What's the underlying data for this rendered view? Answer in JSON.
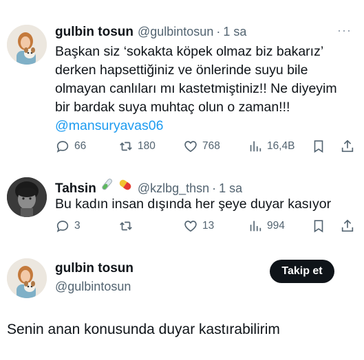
{
  "tweet1": {
    "name": "gulbin tosun",
    "handle": "@gulbintosun",
    "dot": "·",
    "time": "1 sa",
    "more": "···",
    "lines": [
      "Başkan siz ‘sokakta köpek olmaz biz bakarız’",
      "derken hapsettiğiniz ve önlerinde suyu bile",
      "olmayan canlıları mı kastetmiştiniz!!  Ne diyeyim",
      "bir bardak suya muhtaç olun o zaman!!!"
    ],
    "mention": "@mansuryavas06",
    "replies": "66",
    "reposts": "180",
    "likes": "768",
    "views": "16,4B"
  },
  "tweet2": {
    "name": "Tahsin",
    "handle": "@kzlbg_thsn",
    "dot": "·",
    "time": "1 sa",
    "text": "Bu kadın insan dışında her şeye duyar kasıyor",
    "replies": "3",
    "reposts": "",
    "likes": "13",
    "views": "994"
  },
  "profile": {
    "name": "gulbin tosun",
    "handle": "@gulbintosun",
    "follow_label": "Takip et"
  },
  "reply": {
    "text": "Senin anan konusunda duyar kastırabilirim"
  },
  "icons": [
    "reply-icon",
    "repost-icon",
    "like-icon",
    "views-icon",
    "bookmark-icon",
    "share-icon",
    "test-tube-icon",
    "pill-icon"
  ]
}
